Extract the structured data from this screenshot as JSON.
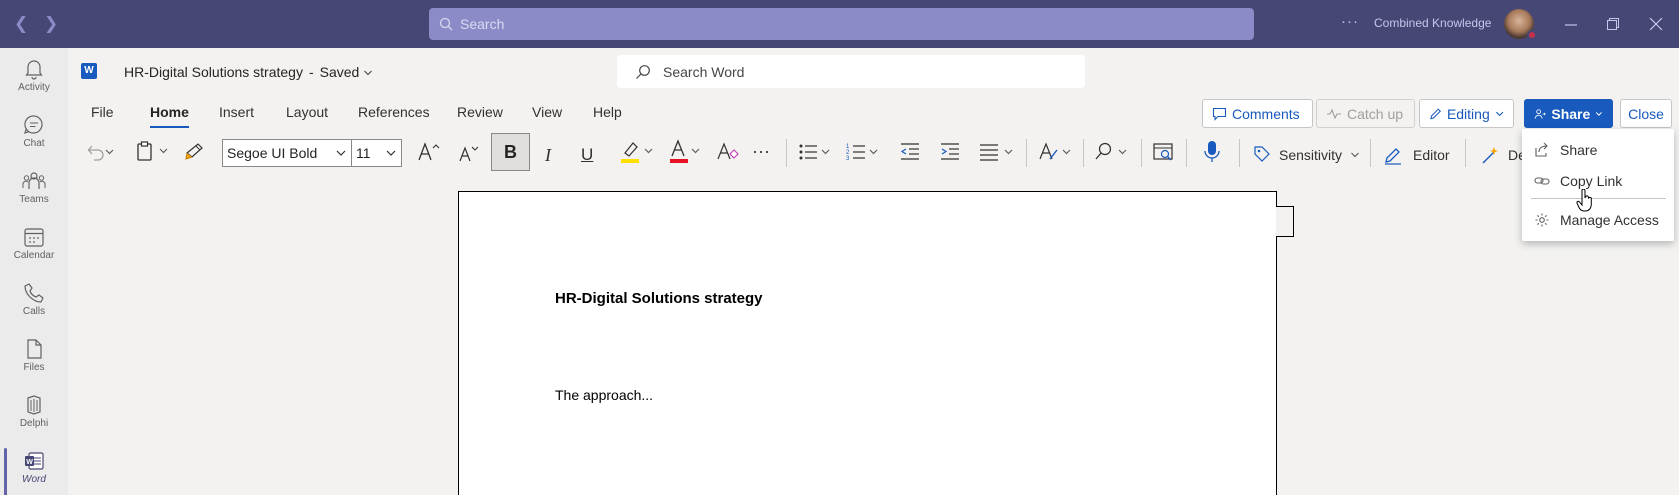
{
  "titlebar": {
    "search_placeholder": "Search",
    "more": "···",
    "org_name": "Combined Knowledge"
  },
  "rail": {
    "items": [
      {
        "label": "Activity",
        "icon": "bell-icon"
      },
      {
        "label": "Chat",
        "icon": "chat-icon"
      },
      {
        "label": "Teams",
        "icon": "teams-icon"
      },
      {
        "label": "Calendar",
        "icon": "calendar-icon"
      },
      {
        "label": "Calls",
        "icon": "phone-icon"
      },
      {
        "label": "Files",
        "icon": "file-icon"
      },
      {
        "label": "Delphi",
        "icon": "delphi-icon"
      },
      {
        "label": "Word",
        "icon": "word-icon"
      }
    ],
    "active": "Word"
  },
  "header": {
    "word_logo": "W",
    "doc_name": "HR-Digital Solutions strategy",
    "separator": "-",
    "status": "Saved",
    "search_placeholder": "Search Word"
  },
  "tabs": [
    "File",
    "Home",
    "Insert",
    "Layout",
    "References",
    "Review",
    "View",
    "Help"
  ],
  "active_tab": "Home",
  "actions": {
    "comments": "Comments",
    "catch_up": "Catch up",
    "editing": "Editing",
    "share": "Share",
    "close": "Close"
  },
  "ribbon": {
    "font": "Segoe UI Bold",
    "size": "11",
    "bold": "B",
    "italic": "I",
    "underline": "U",
    "more": "···",
    "sensitivity": "Sensitivity",
    "editor": "Editor",
    "designer_partial": "De"
  },
  "document": {
    "heading": "HR-Digital Solutions strategy",
    "body": "The approach..."
  },
  "share_menu": {
    "items": [
      "Share",
      "Copy Link",
      "Manage Access"
    ]
  },
  "colors": {
    "titlebar": "#464775",
    "word_blue": "#185abd",
    "highlight": "#ffe000",
    "font_color": "#e81123"
  }
}
